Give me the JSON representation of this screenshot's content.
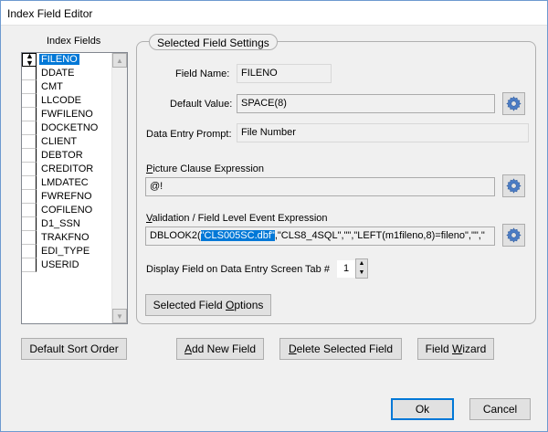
{
  "window": {
    "title": "Index Field Editor"
  },
  "index_fields": {
    "label": "Index Fields",
    "items": [
      "FILENO",
      "DDATE",
      "CMT",
      "LLCODE",
      "FWFILENO",
      "DOCKETNO",
      "CLIENT",
      "DEBTOR",
      "CREDITOR",
      "LMDATEC",
      "FWREFNO",
      "COFILENO",
      "D1_SSN",
      "TRAKFNO",
      "EDI_TYPE",
      "USERID"
    ],
    "selected_index": 0
  },
  "settings": {
    "group_label": "Selected Field Settings",
    "field_name_label": "Field Name:",
    "field_name_value": "FILENO",
    "default_value_label": "Default Value:",
    "default_value": "SPACE(8)",
    "prompt_label": "Data Entry Prompt:",
    "prompt_value": "File Number",
    "picture_label_first": "P",
    "picture_label_rest": "icture Clause Expression",
    "picture_value": "@!",
    "validation_label_first": "V",
    "validation_label_rest": "alidation / Field Level Event Expression",
    "validation_prefix": "DBLOOK2(",
    "validation_highlight": "\"CLS005SC.dbf\"",
    "validation_suffix": ",\"CLS8_4SQL\",\"\",\"LEFT(m1fileno,8)=fileno\",\"\",\"",
    "tab_label": "Display Field on Data Entry Screen Tab #",
    "tab_value": "1",
    "options_button_pre": "Selected Field ",
    "options_button_ul": "O",
    "options_button_post": "ptions"
  },
  "buttons": {
    "default_sort": "Default Sort Order",
    "add_ul": "A",
    "add_rest": "dd New Field",
    "delete_ul": "D",
    "delete_rest": "elete Selected Field",
    "wizard_pre": "Field ",
    "wizard_ul": "W",
    "wizard_post": "izard",
    "ok": "Ok",
    "cancel": "Cancel"
  },
  "icons": {
    "gear": "gear-icon",
    "list_sort": "up-down-arrows-icon",
    "scroll_up": "triangle-up-icon",
    "scroll_down": "triangle-down-icon"
  },
  "colors": {
    "selection": "#0078d7",
    "window_bg": "#f0f0f0"
  }
}
